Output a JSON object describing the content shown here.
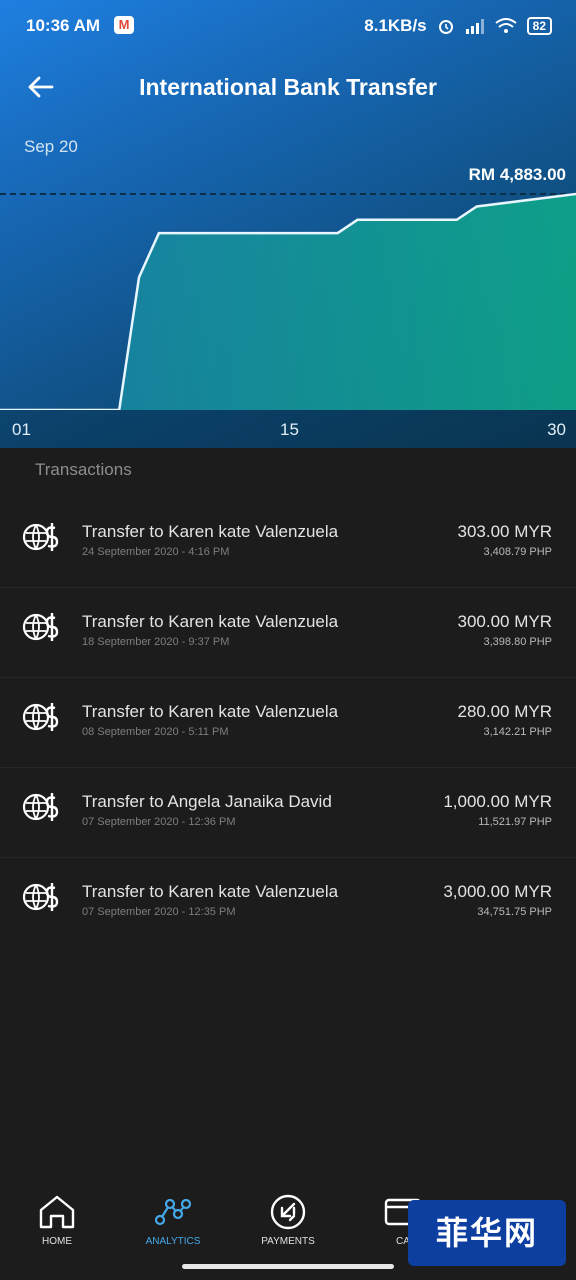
{
  "status_bar": {
    "time": "10:36 AM",
    "mail_icon": "M",
    "net_speed": "8.1KB/s",
    "battery": "82"
  },
  "header": {
    "title": "International Bank Transfer",
    "back_icon": "arrow-left-icon"
  },
  "summary": {
    "month": "Sep 20",
    "total": "RM 4,883.00"
  },
  "chart_data": {
    "type": "area",
    "title": "",
    "x": [
      1,
      7,
      8,
      9,
      18,
      19,
      24,
      25,
      30
    ],
    "y": [
      0,
      0,
      3000,
      4000,
      4000,
      4300,
      4300,
      4600,
      4883
    ],
    "x_ticks": [
      "01",
      "15",
      "30"
    ],
    "xlim": [
      1,
      30
    ],
    "ylim": [
      0,
      4883
    ],
    "reference_line": "RM 4,883.00"
  },
  "section_title": "Transactions",
  "transactions": [
    {
      "title": "Transfer to Karen kate Valenzuela",
      "date": "24 September 2020 - 4:16 PM",
      "amount": "303.00 MYR",
      "sub": "3,408.79 PHP"
    },
    {
      "title": "Transfer to Karen kate Valenzuela",
      "date": "18 September 2020 - 9:37 PM",
      "amount": "300.00 MYR",
      "sub": "3,398.80 PHP"
    },
    {
      "title": "Transfer to Karen kate Valenzuela",
      "date": "08 September 2020 - 5:11 PM",
      "amount": "280.00 MYR",
      "sub": "3,142.21 PHP"
    },
    {
      "title": "Transfer to Angela Janaika David",
      "date": "07 September 2020 - 12:36 PM",
      "amount": "1,000.00 MYR",
      "sub": "11,521.97 PHP"
    },
    {
      "title": "Transfer to Karen kate Valenzuela",
      "date": "07 September 2020 - 12:35 PM",
      "amount": "3,000.00 MYR",
      "sub": "34,751.75 PHP"
    }
  ],
  "bottom_nav": [
    {
      "label": "HOME",
      "icon": "home-icon"
    },
    {
      "label": "ANALYTICS",
      "icon": "analytics-icon",
      "active": true
    },
    {
      "label": "PAYMENTS",
      "icon": "payments-icon"
    },
    {
      "label": "CA",
      "icon": "card-icon"
    }
  ],
  "watermark": "菲华网",
  "colors": {
    "accent": "#45a8e8",
    "header_start": "#1f7fe0",
    "chart_fill": "#10a08a"
  }
}
